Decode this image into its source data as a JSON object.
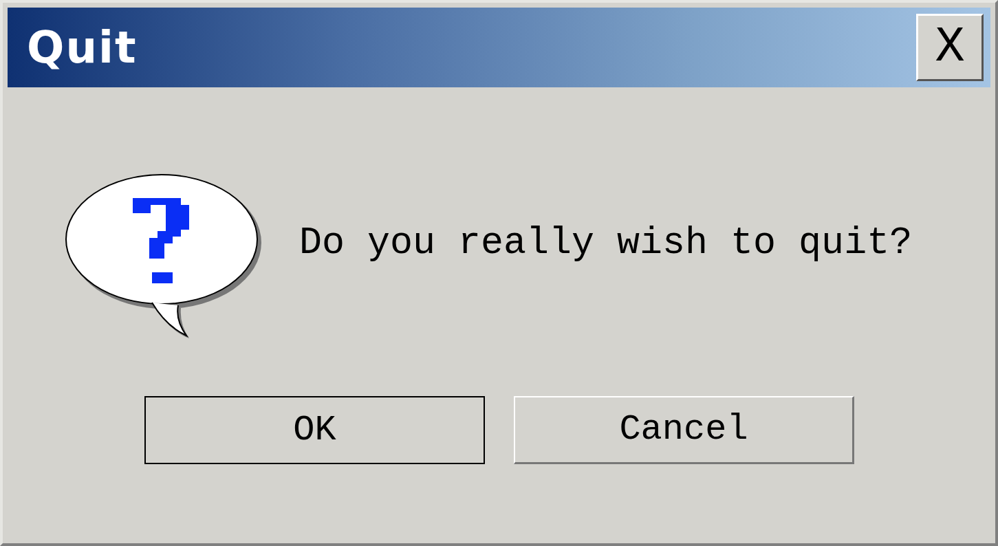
{
  "window": {
    "title": "Quit",
    "close_label": "X"
  },
  "message": "Do you really wish to quit?",
  "buttons": [
    {
      "label": "OK",
      "default": true
    },
    {
      "label": "Cancel",
      "default": false
    }
  ]
}
